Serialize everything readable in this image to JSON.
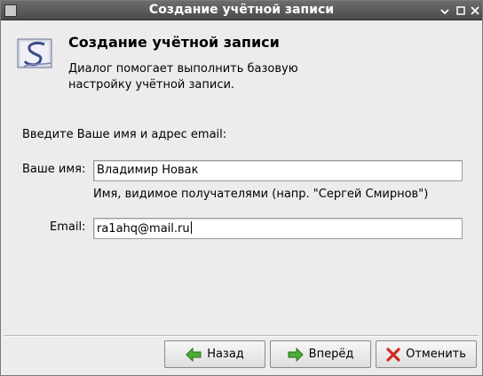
{
  "window": {
    "title": "Создание учётной записи"
  },
  "header": {
    "title": "Создание учётной записи",
    "description": "Диалог помогает выполнить базовую настройку учётной записи.",
    "logo_icon": "evolution-logo-icon"
  },
  "form": {
    "prompt": "Введите Ваше имя и адрес email:",
    "name_label": "Ваше имя:",
    "name_value": "Владимир Новак",
    "name_hint": "Имя, видимое получателями (напр. \"Сергей Смирнов\")",
    "email_label": "Email:",
    "email_value": "ra1ahq@mail.ru"
  },
  "buttons": {
    "back": "Назад",
    "next": "Вперёд",
    "cancel": "Отменить"
  },
  "colors": {
    "arrow_green": "#3c9a2c",
    "cancel_red": "#d12a1d",
    "titlebar": "#555555"
  }
}
